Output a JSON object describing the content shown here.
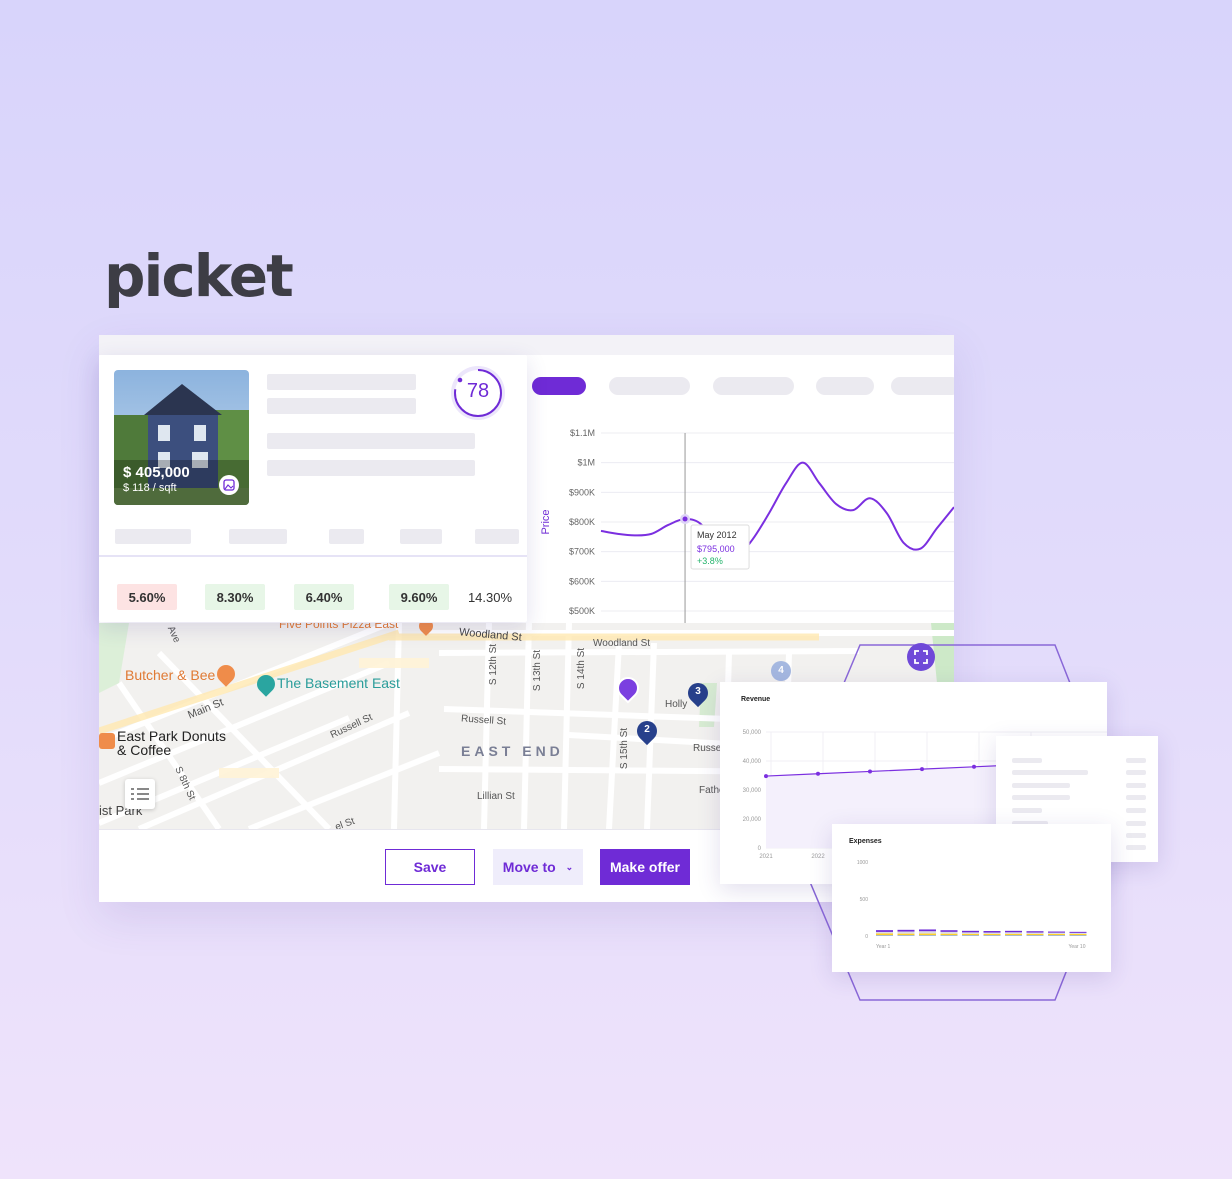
{
  "brand": {
    "logo": "picket"
  },
  "listing": {
    "price": "$ 405,000",
    "price_per_sqft": "$ 118 / sqft",
    "score": "78",
    "metrics": [
      {
        "value": "5.60%",
        "tone": "negative"
      },
      {
        "value": "8.30%",
        "tone": "positive"
      },
      {
        "value": "6.40%",
        "tone": "positive"
      },
      {
        "value": "9.60%",
        "tone": "positive"
      },
      {
        "value": "14.30%",
        "tone": "neutral"
      }
    ]
  },
  "chart_data": [
    {
      "type": "line",
      "ylabel": "Price",
      "yticks": [
        "$1.1M",
        "$1M",
        "$900K",
        "$800K",
        "$700K",
        "$600K",
        "$500K"
      ],
      "ylim": [
        500000,
        1100000
      ],
      "values": [
        770000,
        760000,
        755000,
        760000,
        790000,
        810000,
        790000,
        700000,
        680000,
        740000,
        830000,
        930000,
        1000000,
        930000,
        860000,
        840000,
        880000,
        830000,
        730000,
        710000,
        780000,
        850000
      ],
      "highlight": {
        "index": 5,
        "label": "May 2012",
        "value_text": "$795,000",
        "change": "+3.8%"
      },
      "color": "#7b2fe0"
    },
    {
      "type": "line",
      "title": "Revenue",
      "yticks": [
        "50,000",
        "40,000",
        "30,000",
        "20,000",
        "0"
      ],
      "ylim": [
        0,
        50000
      ],
      "categories": [
        "2021",
        "2022",
        "",
        "",
        "",
        ""
      ],
      "values": [
        31000,
        32000,
        33000,
        34000,
        35000,
        36000
      ],
      "color": "#7b2fe0"
    },
    {
      "type": "bar",
      "title": "Expenses",
      "yticks": [
        "1000",
        "500",
        "0"
      ],
      "ylim": [
        0,
        1000
      ],
      "xlabels": [
        "Year 1",
        "Year 10"
      ],
      "segment_colors": [
        "#4a86d8",
        "#39c3c7",
        "#f08fb9",
        "#ffd02a",
        "#dcdce0",
        "#6f2bd6"
      ],
      "stacks": [
        [
          40,
          60,
          50,
          250,
          250,
          280
        ],
        [
          40,
          60,
          50,
          230,
          330,
          270
        ],
        [
          40,
          60,
          50,
          240,
          370,
          280
        ],
        [
          40,
          60,
          50,
          220,
          290,
          260
        ],
        [
          40,
          60,
          50,
          200,
          230,
          240
        ],
        [
          40,
          60,
          50,
          190,
          210,
          240
        ],
        [
          40,
          60,
          50,
          200,
          240,
          230
        ],
        [
          40,
          60,
          50,
          190,
          210,
          210
        ],
        [
          40,
          60,
          50,
          180,
          200,
          180
        ],
        [
          40,
          60,
          50,
          170,
          180,
          160
        ]
      ]
    }
  ],
  "map": {
    "district": "EAST END",
    "pois": [
      {
        "name": "Butcher & Bee",
        "color": "#e07a34"
      },
      {
        "name": "The Basement East",
        "color": "#2a9d9a"
      },
      {
        "name": "East Park Donuts & Coffee",
        "color": "#222"
      },
      {
        "name": "Five Points Pizza East",
        "color": "#e07a34"
      }
    ],
    "streets": [
      "Woodland St",
      "Woodland St",
      "Main St",
      "Russell St",
      "Russell St",
      "Holly",
      "Lillian St",
      "S 12th St",
      "S 13th St",
      "S 14th St",
      "S 15th St",
      "S 8th St",
      "Ave",
      "Russell",
      "Father",
      "ist Park",
      "el St"
    ],
    "markers": [
      "2",
      "3",
      "4"
    ]
  },
  "actions": {
    "save": "Save",
    "move_to": "Move to",
    "make_offer": "Make offer"
  },
  "colors": {
    "accent": "#6f2bd6",
    "negative_bg": "#fde3e3",
    "positive_bg": "#e7f6e7"
  }
}
